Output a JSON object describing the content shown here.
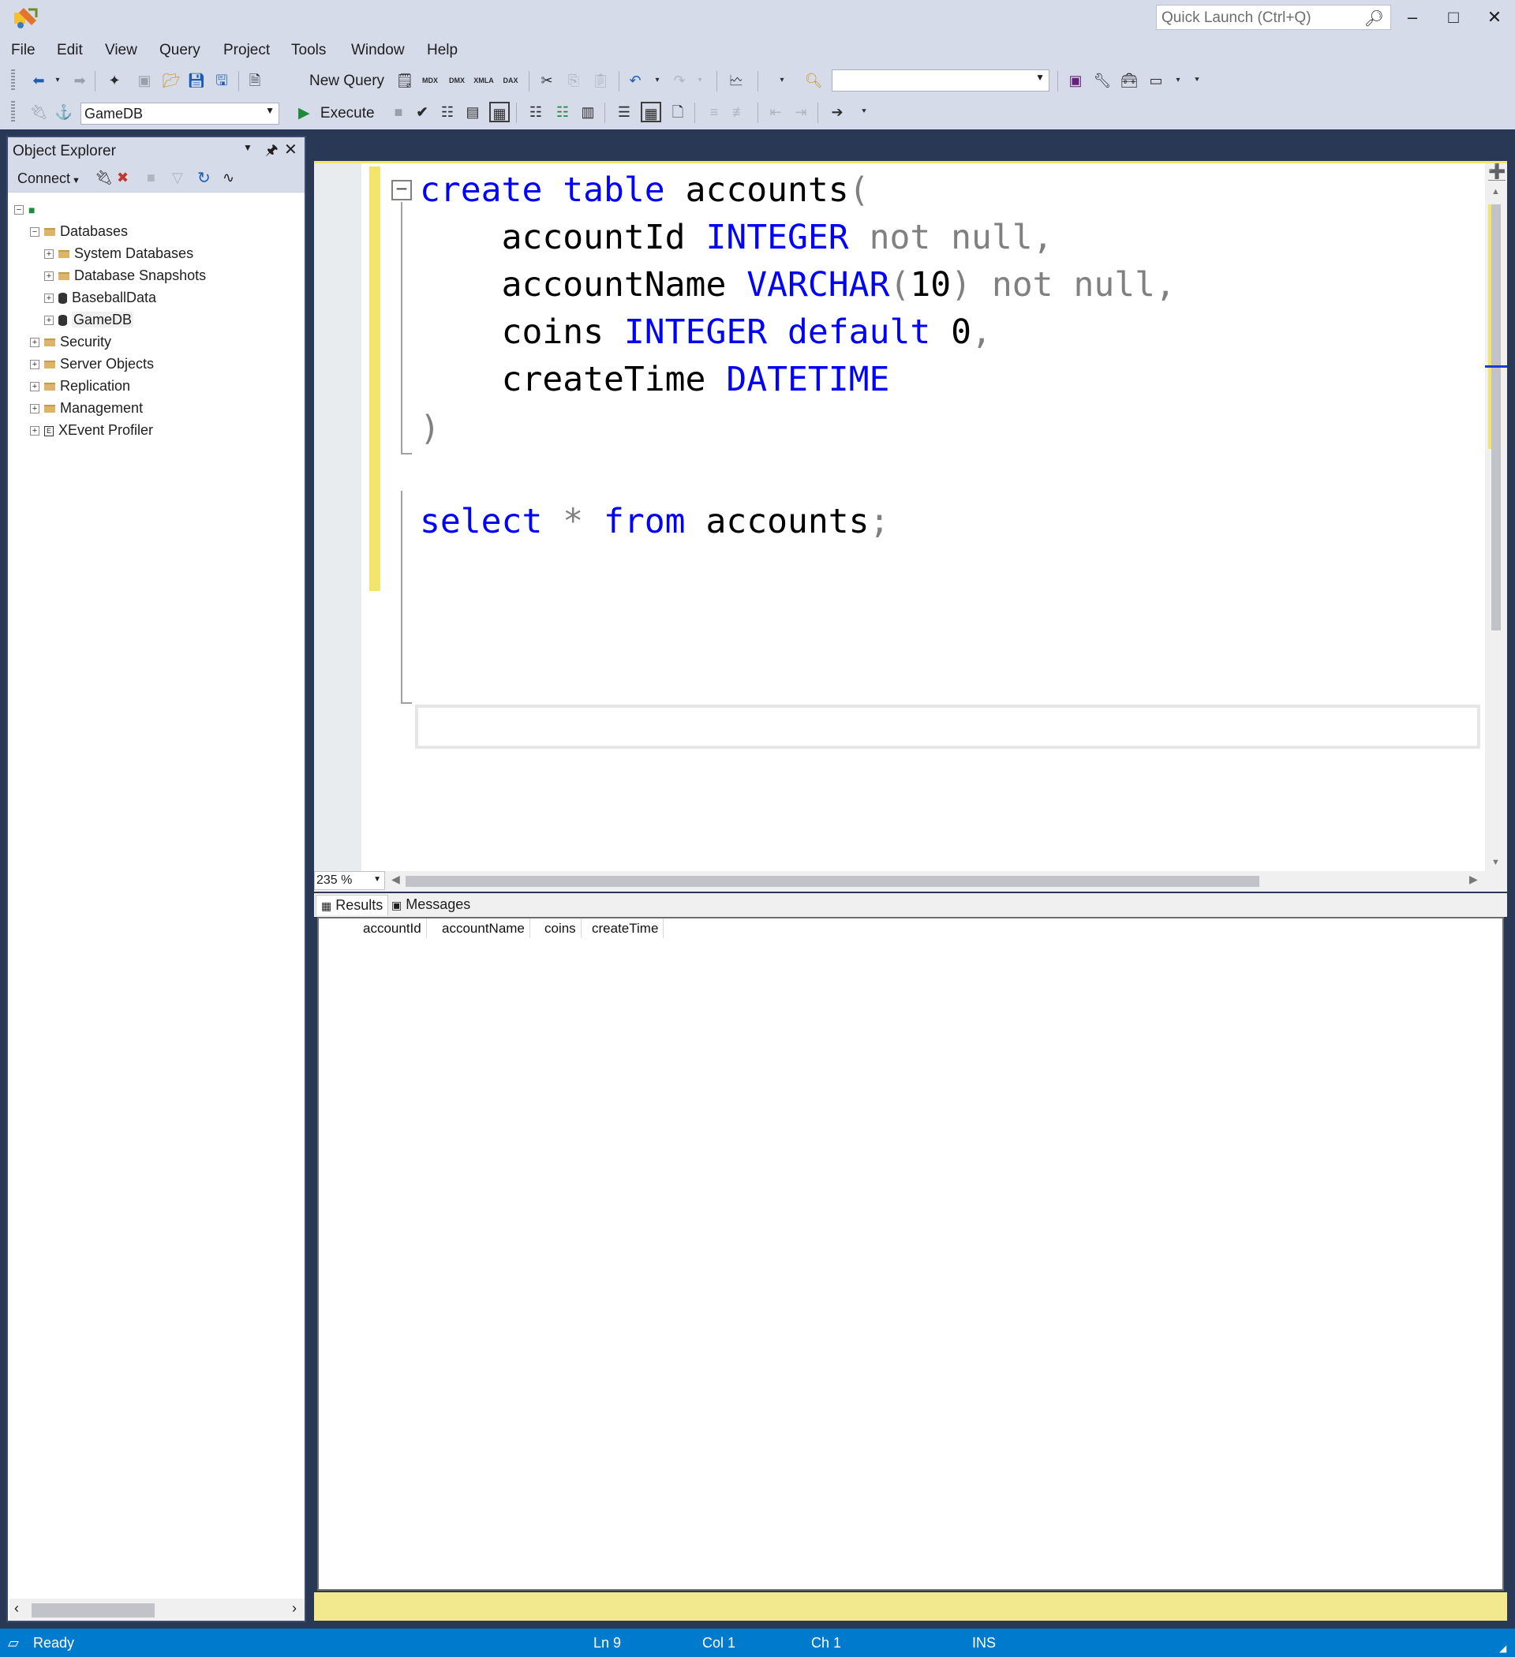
{
  "title_bar": {
    "quick_launch_placeholder": "Quick Launch (Ctrl+Q)",
    "minimize_label": "–",
    "maximize_label": "□",
    "close_label": "✕"
  },
  "menu": {
    "items": [
      "File",
      "Edit",
      "View",
      "Query",
      "Project",
      "Tools",
      "Window",
      "Help"
    ]
  },
  "toolbar": {
    "new_query_label": "New Query",
    "mdx": "MDX",
    "dmx": "DMX",
    "xmla": "XMLA",
    "dax": "DAX",
    "database_selected": "GameDB",
    "execute_label": "Execute"
  },
  "object_explorer": {
    "title": "Object Explorer",
    "connect_label": "Connect",
    "tree": [
      {
        "label": "Databases"
      },
      {
        "label": "System Databases"
      },
      {
        "label": "Database Snapshots"
      },
      {
        "label": "BaseballData"
      },
      {
        "label": "GameDB"
      },
      {
        "label": "Security"
      },
      {
        "label": "Server Objects"
      },
      {
        "label": "Replication"
      },
      {
        "label": "Management"
      },
      {
        "label": "XEvent Profiler"
      }
    ]
  },
  "editor": {
    "line1": {
      "k1": "create",
      "k2": "table",
      "t": "accounts",
      "p": "("
    },
    "line2": {
      "c": "accountId",
      "k": "INTEGER",
      "g": "not null,"
    },
    "line3": {
      "c": "accountName",
      "k": "VARCHAR",
      "p1": "(",
      "n": "10",
      "p2": ")",
      "g": "not null,"
    },
    "line4": {
      "c": "coins",
      "k1": "INTEGER",
      "k2": "default",
      "n": "0",
      "g": ","
    },
    "line5": {
      "c": "createTime",
      "k": "DATETIME"
    },
    "line6": {
      "p": ")"
    },
    "line8": {
      "k1": "select",
      "s": "*",
      "k2": "from",
      "t": "accounts",
      "g": ";"
    },
    "zoom": "235 %"
  },
  "results": {
    "tab_results": "Results",
    "tab_messages": "Messages",
    "columns": [
      "accountId",
      "accountName",
      "coins",
      "createTime"
    ]
  },
  "status": {
    "state": "Ready",
    "ln": "Ln 9",
    "col": "Col 1",
    "ch": "Ch 1",
    "mode": "INS",
    "accent": "#007acc"
  }
}
